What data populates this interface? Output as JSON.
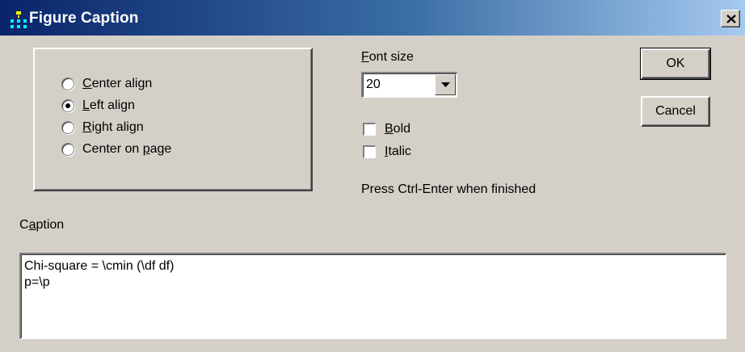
{
  "window": {
    "title": "Figure Caption",
    "icon": "figure-app-icon",
    "close_icon": "close-icon"
  },
  "alignment": {
    "options": [
      {
        "pre": "",
        "key": "C",
        "post": "enter align",
        "checked": false
      },
      {
        "pre": "",
        "key": "L",
        "post": "eft align",
        "checked": true
      },
      {
        "pre": "",
        "key": "R",
        "post": "ight align",
        "checked": false
      },
      {
        "pre": "Center on ",
        "key": "p",
        "post": "age",
        "checked": false
      }
    ]
  },
  "font_size": {
    "label_key": "F",
    "label_rest": "ont size",
    "value": "20"
  },
  "bold": {
    "key": "B",
    "rest": "old",
    "checked": false
  },
  "italic": {
    "key": "I",
    "rest": "talic",
    "checked": false
  },
  "hint": "Press Ctrl-Enter when finished",
  "buttons": {
    "ok": "OK",
    "cancel": "Cancel"
  },
  "caption": {
    "label_pre": "C",
    "label_key": "a",
    "label_post": "ption",
    "text": "Chi-square = \\cmin (\\df df)\np=\\p"
  }
}
